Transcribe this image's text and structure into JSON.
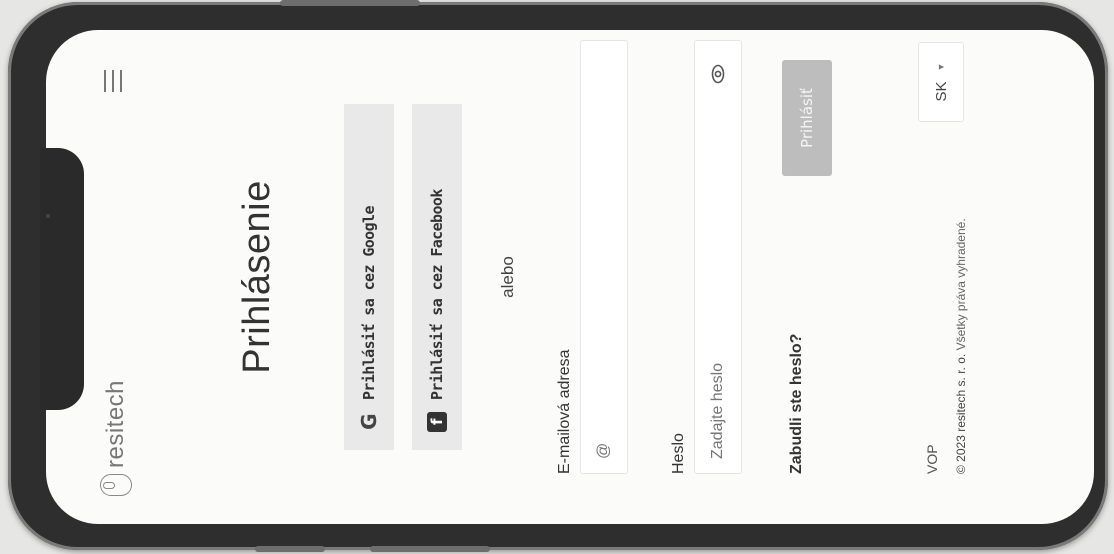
{
  "header": {
    "brand": "resitech"
  },
  "main": {
    "title": "Prihlásenie",
    "google_label": "Prihlásiť sa cez Google",
    "facebook_label": "Prihlásiť sa cez Facebook",
    "or_text": "alebo",
    "email": {
      "label": "E-mailová adresa",
      "placeholder": "@"
    },
    "password": {
      "label": "Heslo",
      "placeholder": "Zadajte heslo"
    },
    "forgot_label": "Zabudli ste heslo?",
    "login_label": "Prihlásiť"
  },
  "footer": {
    "terms_label": "VOP",
    "copyright": "© 2023 resitech s. r. o.",
    "rights": "Všetky práva vyhradené.",
    "language": "SK"
  },
  "icons": {
    "menu": "hamburger-icon",
    "google": "google-icon",
    "facebook": "facebook-icon",
    "eye": "eye-icon",
    "lang_arrow": "caret-down-icon"
  },
  "colors": {
    "login_button_bg": "#bdbdbd",
    "social_button_bg": "#e9e9e9"
  }
}
